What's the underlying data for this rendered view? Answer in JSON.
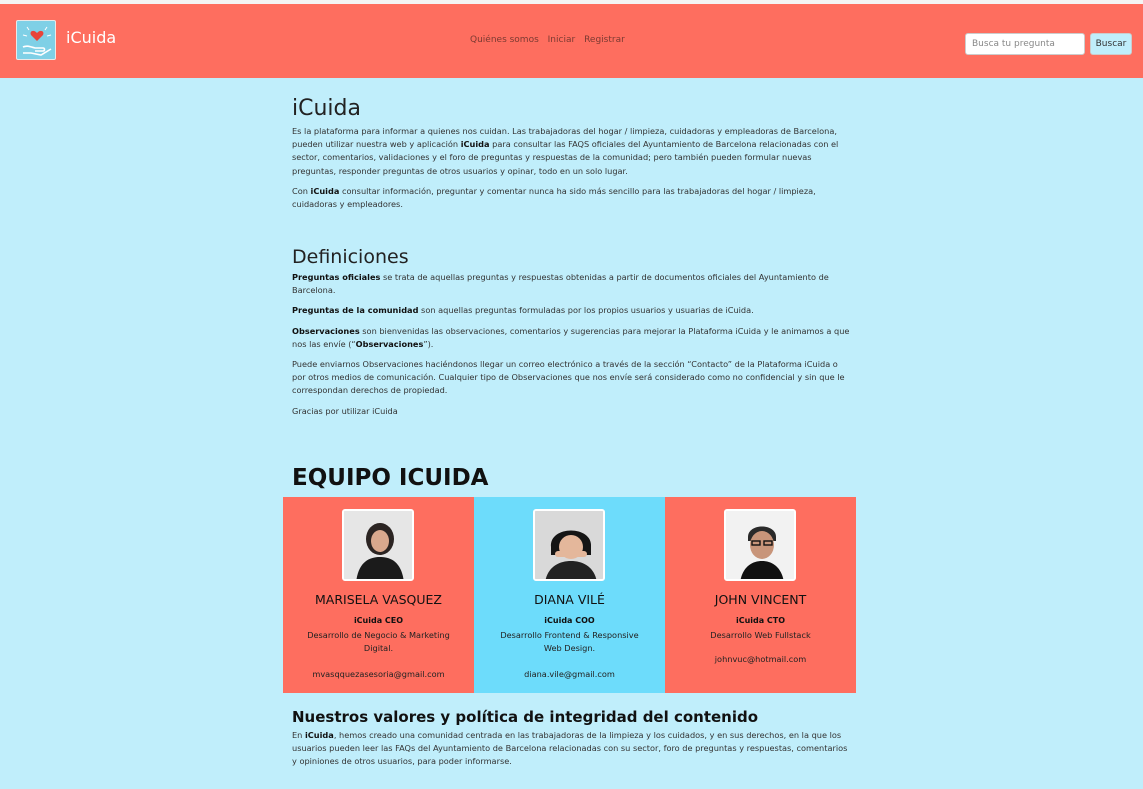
{
  "navbar": {
    "brand": "iCuida",
    "links": [
      "Quiénes somos",
      "Iniciar",
      "Registrar"
    ],
    "search_placeholder": "Busca tu pregunta",
    "search_button": "Buscar",
    "colors": {
      "navbar_bg": "#fe6e5f",
      "page_bg": "#c0eefb"
    }
  },
  "intro": {
    "title": "iCuida",
    "p1_pre": "Es la plataforma para informar a quienes nos cuidan. Las trabajadoras del hogar / limpieza, cuidadoras y empleadoras de Barcelona, pueden utilizar nuestra web y aplicación ",
    "p1_bold": "iCuida",
    "p1_post": " para consultar las FAQS oficiales del Ayuntamiento de Barcelona relacionadas con el sector, comentarios, validaciones y el foro de preguntas y respuestas de la comunidad; pero también pueden formular nuevas preguntas, responder preguntas de otros usuarios y opinar, todo en un solo lugar.",
    "p2_pre": "Con ",
    "p2_bold": "iCuida",
    "p2_post": " consultar información, preguntar y comentar nunca ha sido más sencillo para las trabajadoras del hogar / limpieza, cuidadoras y empleadores."
  },
  "definiciones": {
    "title": "Definiciones",
    "d1_bold": "Preguntas oficiales",
    "d1_text": " se trata de aquellas preguntas y respuestas obtenidas a partir de documentos oficiales del Ayuntamiento de Barcelona.",
    "d2_bold": "Preguntas de la comunidad",
    "d2_text": " son aquellas preguntas formuladas por los propios usuarios y usuarias de iCuida.",
    "d3_bold": "Observaciones",
    "d3_text": " son bienvenidas las observaciones, comentarios y sugerencias para mejorar la Plataforma iCuida y le animamos a que nos las envíe (“",
    "d3_bold2": "Observaciones",
    "d3_end": "”).",
    "p4": "Puede enviarnos Observaciones haciéndonos llegar un correo electrónico a través de la sección “Contacto” de la Plataforma iCuida o por otros medios de comunicación. Cualquier tipo de Observaciones que nos envíe será considerado como no confidencial y sin que le correspondan derechos de propiedad.",
    "p5": "Gracias por utilizar iCuida"
  },
  "equipo": {
    "title": "EQUIPO ICUIDA",
    "members": [
      {
        "name": "MARISELA VASQUEZ",
        "role": "iCuida CEO",
        "desc": "Desarrollo de Negocio & Marketing Digital.",
        "email": "mvasqquezasesoria@gmail.com"
      },
      {
        "name": "DIANA VILÉ",
        "role": "iCuida COO",
        "desc": "Desarrollo Frontend & Responsive Web Design.",
        "email": "diana.vile@gmail.com"
      },
      {
        "name": "JOHN VINCENT",
        "role": "iCuida CTO",
        "desc": "Desarrollo Web Fullstack",
        "email": "johnvuc@hotmail.com"
      }
    ]
  },
  "valores": {
    "title": "Nuestros valores y política de integridad del contenido",
    "p_pre": "En ",
    "p_bold": "iCuida",
    "p_post": ", hemos creado una comunidad centrada en las trabajadoras de la limpieza y los cuidados, y en sus derechos, en la que los usuarios pueden leer las FAQs del Ayuntamiento de Barcelona relacionadas con su sector, foro de preguntas y respuestas, comentarios y opiniones de otros usuarios, para poder informarse."
  }
}
